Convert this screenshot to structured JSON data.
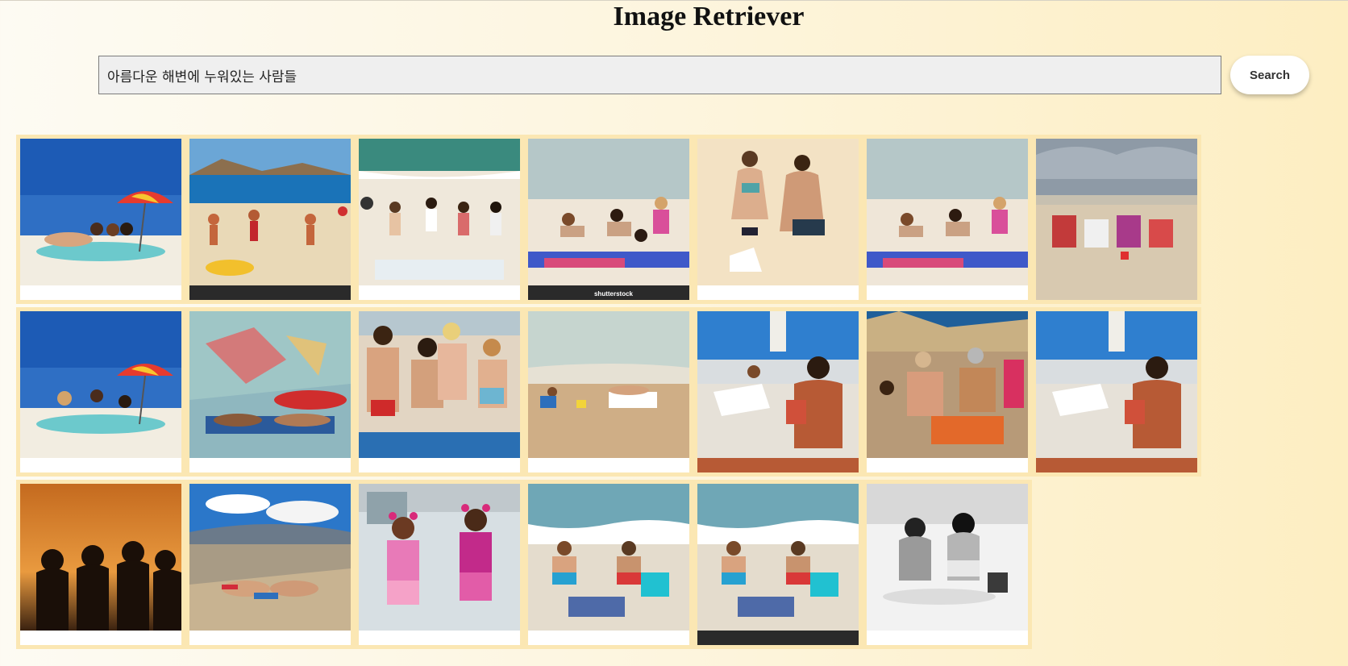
{
  "app": {
    "title": "Image Retriever"
  },
  "search": {
    "query": "아름다운 해변에 누워있는 사람들",
    "button_label": "Search"
  },
  "results": {
    "rows": 3,
    "count": 20
  },
  "colors": {
    "grid_background": "#fbe7b3",
    "input_background": "#efefef"
  }
}
